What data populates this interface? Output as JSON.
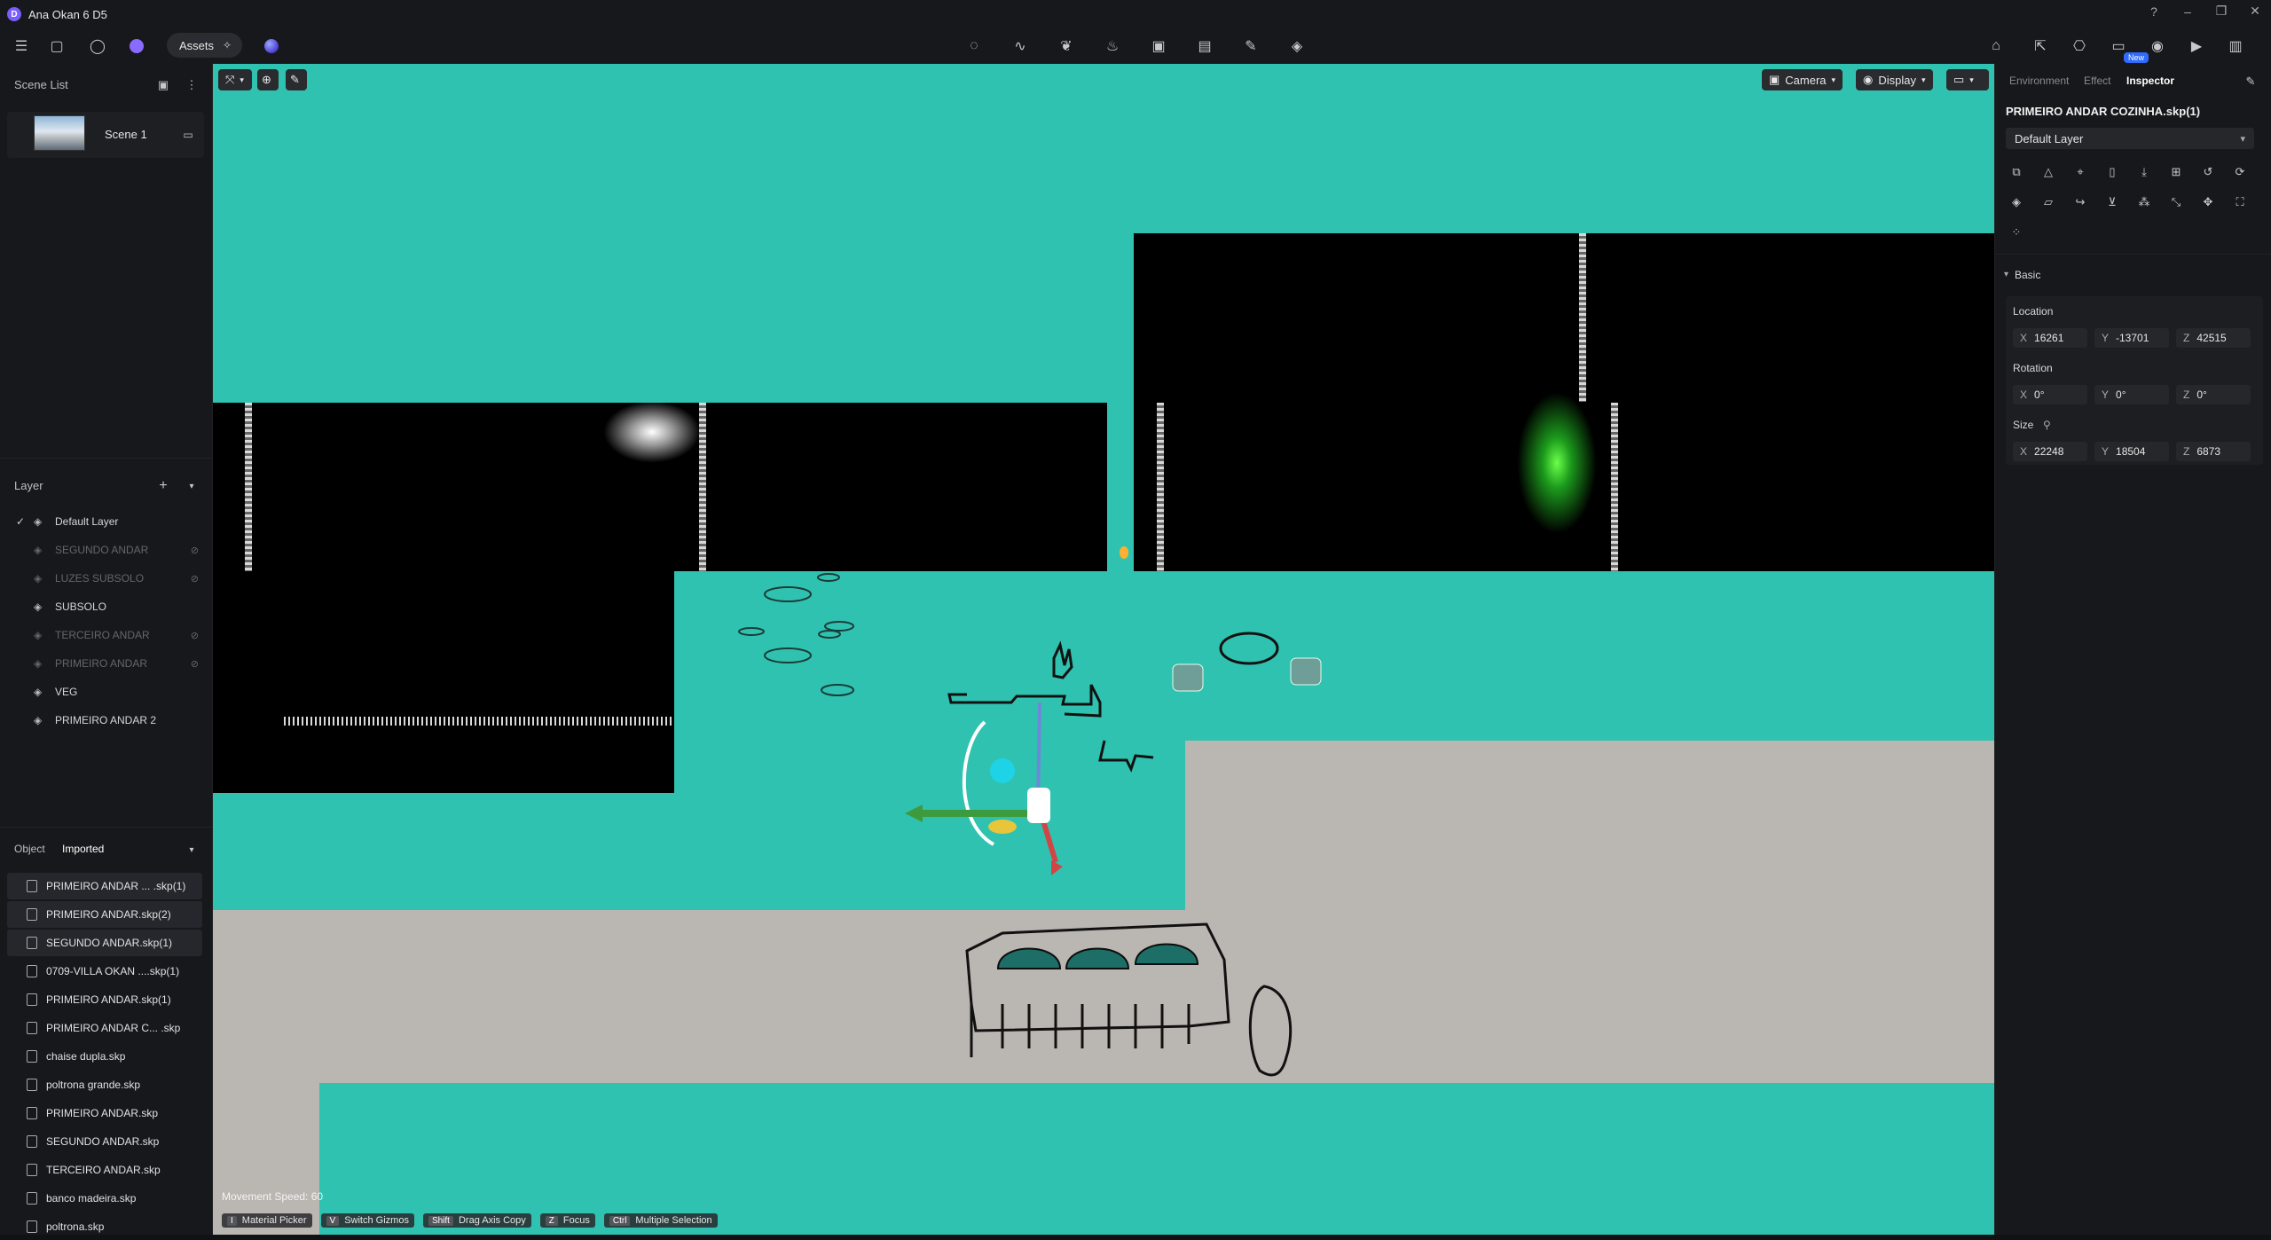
{
  "app": {
    "title": "Ana Okan 6 D5",
    "logo_letter": "D"
  },
  "toolbar": {
    "assets_label": "Assets",
    "new_badge": "New"
  },
  "scene_list": {
    "title": "Scene List",
    "scenes": [
      {
        "name": "Scene 1"
      }
    ]
  },
  "layers": {
    "title": "Layer",
    "items": [
      {
        "name": "Default Layer",
        "checked": true,
        "hidden": false
      },
      {
        "name": "SEGUNDO ANDAR",
        "checked": false,
        "hidden": true
      },
      {
        "name": "LUZES SUBSOLO",
        "checked": false,
        "hidden": true
      },
      {
        "name": "SUBSOLO",
        "checked": false,
        "hidden": false
      },
      {
        "name": "TERCEIRO ANDAR",
        "checked": false,
        "hidden": true
      },
      {
        "name": "PRIMEIRO ANDAR",
        "checked": false,
        "hidden": true
      },
      {
        "name": "VEG",
        "checked": false,
        "hidden": false
      },
      {
        "name": "PRIMEIRO ANDAR 2",
        "checked": false,
        "hidden": false
      }
    ]
  },
  "objects": {
    "tab_object": "Object",
    "tab_imported": "Imported",
    "items": [
      "PRIMEIRO ANDAR ... .skp(1)",
      "PRIMEIRO ANDAR.skp(2)",
      "SEGUNDO ANDAR.skp(1)",
      "0709-VILLA OKAN ....skp(1)",
      "PRIMEIRO ANDAR.skp(1)",
      "PRIMEIRO ANDAR C... .skp",
      "chaise dupla.skp",
      "poltrona grande.skp",
      "PRIMEIRO ANDAR.skp",
      "SEGUNDO ANDAR.skp",
      "TERCEIRO ANDAR.skp",
      "banco madeira.skp",
      "poltrona.skp"
    ]
  },
  "viewport": {
    "camera_label": "Camera",
    "display_label": "Display",
    "movement_speed": "Movement Speed: 60",
    "hints": [
      {
        "key": "I",
        "label": "Material Picker"
      },
      {
        "key": "V",
        "label": "Switch Gizmos"
      },
      {
        "key": "Shift",
        "label": "Drag Axis Copy"
      },
      {
        "key": "Z",
        "label": "Focus"
      },
      {
        "key": "Ctrl",
        "label": "Multiple Selection"
      }
    ]
  },
  "inspector": {
    "tabs": [
      "Environment",
      "Effect",
      "Inspector"
    ],
    "active_tab": "Inspector",
    "object_name": "PRIMEIRO ANDAR COZINHA.skp(1)",
    "layer": "Default Layer",
    "section": "Basic",
    "location_label": "Location",
    "location": {
      "x": "16261",
      "y": "-13701",
      "z": "42515"
    },
    "rotation_label": "Rotation",
    "rotation": {
      "x": "0°",
      "y": "0°",
      "z": "0°"
    },
    "size_label": "Size",
    "size": {
      "x": "22248",
      "y": "18504",
      "z": "6873"
    }
  },
  "colors": {
    "viewport_bg": "#30c2b0",
    "floor": "#bab6b2",
    "accent": "#2f6bff"
  }
}
